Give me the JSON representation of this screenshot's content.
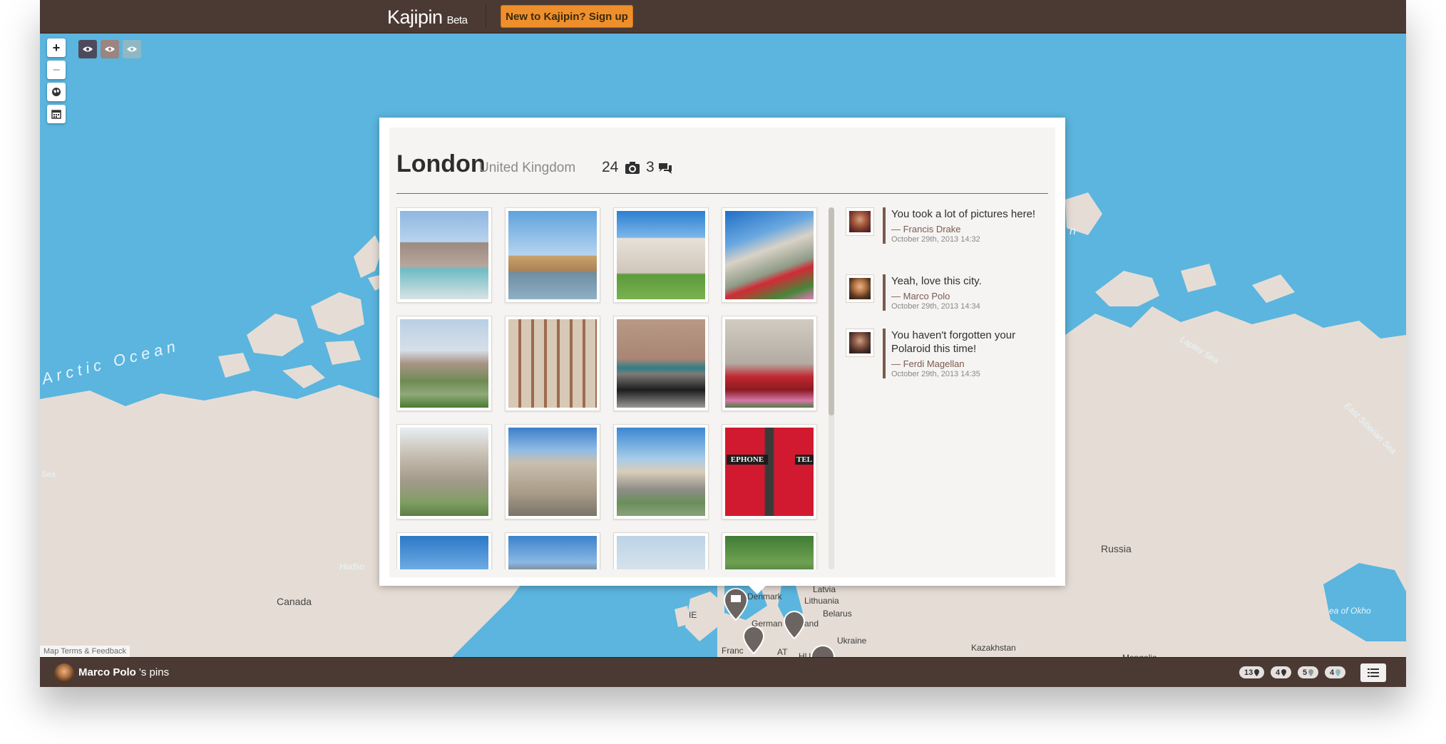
{
  "header": {
    "brand": "Kajipin",
    "brand_tag": "Beta",
    "signup_label": "New to Kajipin? Sign up"
  },
  "map": {
    "controls": {
      "zoom_in": "+",
      "zoom_out": "−"
    },
    "labels": {
      "canada": "Canada",
      "russia": "Russia",
      "kazakhstan": "Kazakhstan",
      "mongolia": "Mongolia",
      "denmark": "Denmark",
      "latvia": "Latvia",
      "lithuania": "Lithuania",
      "belarus": "Belarus",
      "ukraine": "Ukraine",
      "ie": "IE",
      "germany": "German",
      "poland": "and",
      "france": "Franc",
      "at": "AT",
      "hu": "HU"
    },
    "oceans": {
      "arctic": "Arctic Ocean",
      "laptev": "Laptev Sea",
      "east_siberian": "East Siberian Sea",
      "hudson": "Hudso",
      "sea": "Sea",
      "okhotsk": "ea of Okho",
      "cut_n": "n"
    },
    "terms": "Map Terms & Feedback"
  },
  "popup": {
    "city": "London",
    "country": "United Kingdom",
    "photo_count": "24",
    "comment_count": "3",
    "comments": [
      {
        "text": "You took a lot of pictures here!",
        "author": "—  Francis Drake",
        "date": "October 29th, 2013 14:32"
      },
      {
        "text": "Yeah, love this city.",
        "author": "—  Marco Polo",
        "date": "October 29th, 2013 14:34"
      },
      {
        "text": "You haven't forgotten your Polaroid this time!",
        "author": "—  Ferdi Magellan",
        "date": "October 29th, 2013 14:35"
      }
    ],
    "photo_signs": {
      "telephone_left": "EPHONE",
      "telephone_right": "TEL"
    }
  },
  "footer": {
    "user_name": "Marco Polo",
    "suffix": " 's pins",
    "pills": [
      "13",
      "4",
      "5",
      "4"
    ]
  },
  "colors": {
    "ocean": "#5bb5de",
    "land": "#e5ddd5",
    "bar": "#4b3a33",
    "accent_button": "#ee8f2b",
    "comment_border": "#7a5b4f"
  },
  "icons": {
    "zoom_in": "plus-icon",
    "zoom_out": "minus-icon",
    "globe": "globe-icon",
    "calendar": "calendar-icon",
    "eye": "eye-icon",
    "camera": "camera-icon",
    "comments": "comments-icon",
    "list": "list-icon",
    "pin": "map-pin-icon"
  }
}
